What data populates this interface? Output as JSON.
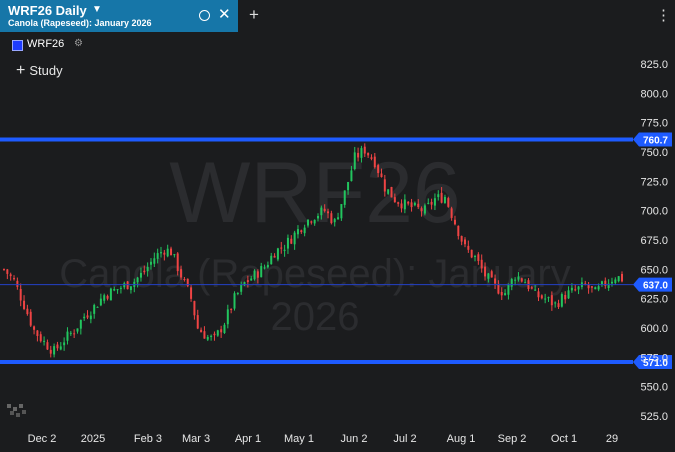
{
  "tab": {
    "title": "WRF26 Daily",
    "subtitle": "Canola (Rapeseed): January 2026"
  },
  "legend": {
    "label": "WRF26"
  },
  "study": {
    "label": "Study"
  },
  "watermark": {
    "symbol": "WRF26",
    "description": "Canola (Rapeseed): January 2026"
  },
  "colors": {
    "up": "#22c55e",
    "down": "#ef4444",
    "level": "#1e5bff",
    "tab": "#1676a8"
  },
  "icons": [
    "caret-down-icon",
    "circle-icon",
    "close-icon",
    "plus-icon",
    "kebab-menu-icon",
    "gear-icon",
    "chart-logo-icon"
  ],
  "chart_data": {
    "type": "candlestick",
    "y_axis": {
      "min": 525,
      "max": 825,
      "ticks": [
        "825.0",
        "800.0",
        "775.0",
        "750.0",
        "725.0",
        "700.0",
        "675.0",
        "650.0",
        "625.0",
        "600.0",
        "575.0",
        "550.0",
        "525.0"
      ]
    },
    "x_axis": {
      "ticks": [
        "Dec 2",
        "2025",
        "Feb 3",
        "Mar 3",
        "Apr 1",
        "May 1",
        "Jun 2",
        "Jul 2",
        "Aug 1",
        "Sep 2",
        "Oct 1",
        "29"
      ]
    },
    "levels": [
      {
        "value": 760.7,
        "label": "760.7",
        "style": "thick"
      },
      {
        "value": 637.0,
        "label": "637.0",
        "style": "thin"
      },
      {
        "value": 571.0,
        "label": "571.0",
        "style": "thick"
      }
    ],
    "price_path": [
      [
        0,
        650
      ],
      [
        3,
        640
      ],
      [
        6,
        620
      ],
      [
        9,
        598
      ],
      [
        12,
        588
      ],
      [
        15,
        580
      ],
      [
        18,
        590
      ],
      [
        21,
        598
      ],
      [
        24,
        610
      ],
      [
        27,
        618
      ],
      [
        30,
        628
      ],
      [
        33,
        632
      ],
      [
        36,
        636
      ],
      [
        39,
        640
      ],
      [
        42,
        648
      ],
      [
        45,
        660
      ],
      [
        48,
        667
      ],
      [
        50,
        665
      ],
      [
        53,
        645
      ],
      [
        56,
        625
      ],
      [
        58,
        600
      ],
      [
        61,
        592
      ],
      [
        63,
        590
      ],
      [
        66,
        605
      ],
      [
        69,
        625
      ],
      [
        72,
        638
      ],
      [
        75,
        645
      ],
      [
        78,
        652
      ],
      [
        81,
        665
      ],
      [
        84,
        670
      ],
      [
        87,
        680
      ],
      [
        90,
        690
      ],
      [
        93,
        696
      ],
      [
        96,
        700
      ],
      [
        99,
        690
      ],
      [
        102,
        715
      ],
      [
        105,
        745
      ],
      [
        108,
        752
      ],
      [
        111,
        742
      ],
      [
        114,
        720
      ],
      [
        117,
        710
      ],
      [
        120,
        705
      ],
      [
        123,
        702
      ],
      [
        126,
        700
      ],
      [
        129,
        710
      ],
      [
        132,
        712
      ],
      [
        135,
        690
      ],
      [
        138,
        668
      ],
      [
        141,
        660
      ],
      [
        144,
        645
      ],
      [
        147,
        635
      ],
      [
        150,
        630
      ],
      [
        153,
        645
      ],
      [
        156,
        640
      ],
      [
        159,
        628
      ],
      [
        162,
        625
      ],
      [
        165,
        620
      ],
      [
        168,
        628
      ],
      [
        171,
        632
      ],
      [
        174,
        636
      ],
      [
        177,
        630
      ],
      [
        180,
        638
      ],
      [
        183,
        644
      ],
      [
        185,
        642
      ]
    ]
  }
}
